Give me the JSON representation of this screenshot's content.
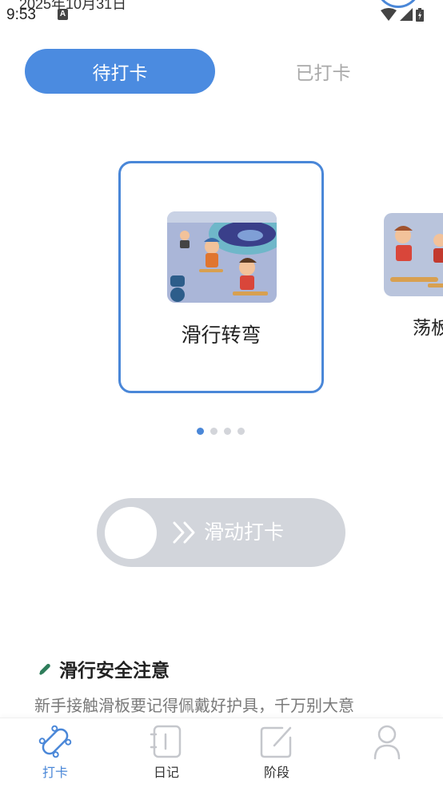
{
  "status_bar": {
    "date": "2025年10月31日",
    "time": "9:53",
    "a_badge": "A"
  },
  "tabs": {
    "pending": "待打卡",
    "done": "已打卡"
  },
  "carousel": {
    "items": [
      {
        "title": "滑行转弯"
      },
      {
        "title": "荡板"
      }
    ],
    "page_count": 4,
    "active_page": 1
  },
  "slider": {
    "label": "滑动打卡"
  },
  "tips": {
    "title": "滑行安全注意",
    "text": "新手接触滑板要记得佩戴好护具，千万别大意"
  },
  "bottom_nav": {
    "items": [
      {
        "label": "打卡",
        "icon": "skateboard-icon",
        "active": true
      },
      {
        "label": "日记",
        "icon": "notebook-icon",
        "active": false
      },
      {
        "label": "阶段",
        "icon": "edit-icon",
        "active": false
      },
      {
        "label": "",
        "icon": "person-icon",
        "active": false
      }
    ]
  },
  "colors": {
    "accent": "#4a87d8",
    "tab_active_bg": "#4b8be0",
    "slider_bg": "#d2d5db",
    "inactive_text": "#a9a9a9"
  }
}
